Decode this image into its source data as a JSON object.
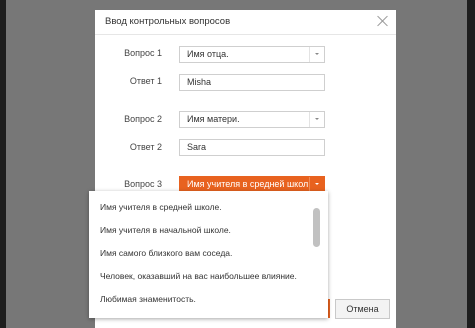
{
  "dialog": {
    "title": "Ввод контрольных вопросов",
    "cancel_label": "Отмена"
  },
  "form": {
    "q1_label": "Вопрос 1",
    "q1_value": "Имя отца.",
    "a1_label": "Ответ 1",
    "a1_value": "Misha",
    "q2_label": "Вопрос 2",
    "q2_value": "Имя матери.",
    "a2_label": "Ответ 2",
    "a2_value": "Sara",
    "q3_label": "Вопрос 3",
    "q3_value": "Имя учителя в средней школ"
  },
  "dropdown": {
    "options": [
      "Имя учителя в средней школе.",
      "Имя учителя в начальной школе.",
      "Имя самого близкого вам соседа.",
      "Человек, оказавший на вас наибольшее влияние.",
      "Любимая знаменитость."
    ]
  },
  "colors": {
    "accent": "#e8621f",
    "overlay": "#777777"
  }
}
